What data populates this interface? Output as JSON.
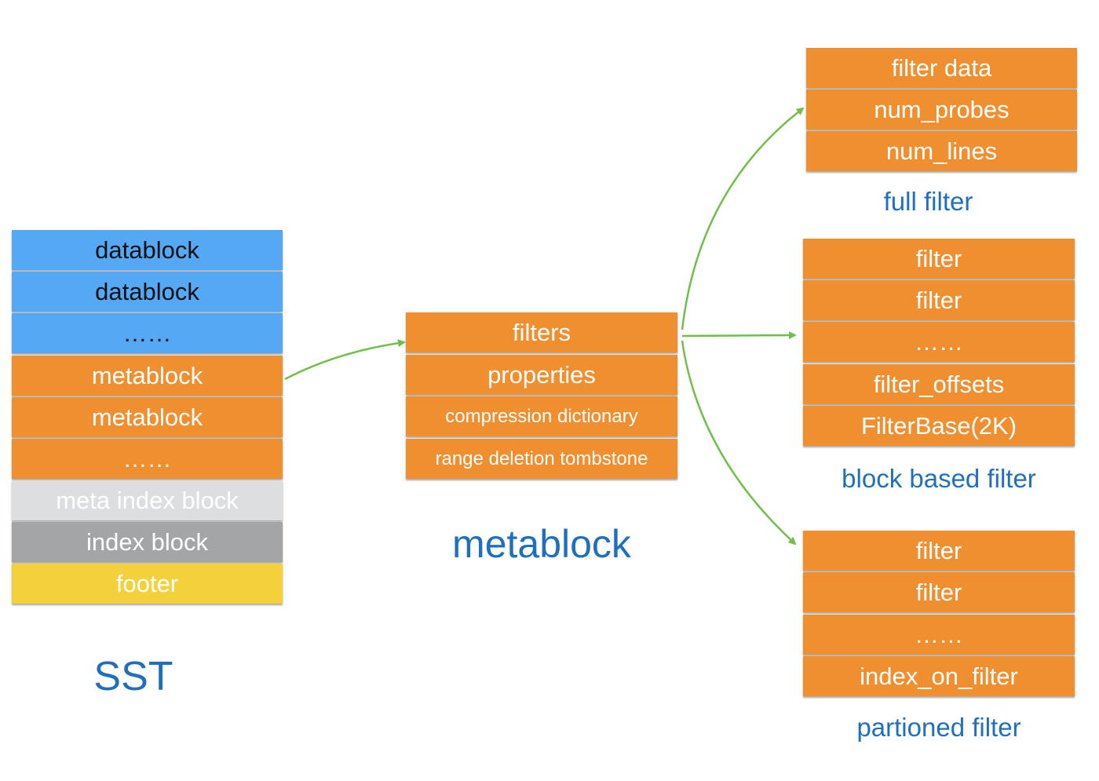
{
  "sst": {
    "title": "SST",
    "blocks": [
      {
        "label": "datablock",
        "color": "#55a8f3"
      },
      {
        "label": "datablock",
        "color": "#55a8f3"
      },
      {
        "label": "……",
        "color": "#55a8f3"
      },
      {
        "label": "metablock",
        "color": "#f08f30"
      },
      {
        "label": "metablock",
        "color": "#f08f30"
      },
      {
        "label": "……",
        "color": "#f08f30"
      },
      {
        "label": "meta index block",
        "color": "#dcdedf"
      },
      {
        "label": "index block",
        "color": "#a3a5a6"
      },
      {
        "label": "footer",
        "color": "#f4d13b"
      }
    ]
  },
  "metablock": {
    "title": "metablock",
    "blocks": [
      "filters",
      "properties",
      "compression dictionary",
      "range deletion tombstone"
    ]
  },
  "full_filter": {
    "title": "full filter",
    "blocks": [
      "filter data",
      "num_probes",
      "num_lines"
    ]
  },
  "block_based_filter": {
    "title": "block based filter",
    "blocks": [
      "filter",
      "filter",
      "……",
      "filter_offsets",
      "FilterBase(2K)"
    ]
  },
  "partitioned_filter": {
    "title": "partioned filter",
    "blocks": [
      "filter",
      "filter",
      "……",
      "index_on_filter"
    ]
  },
  "arrow_color": "#6fbf4a"
}
